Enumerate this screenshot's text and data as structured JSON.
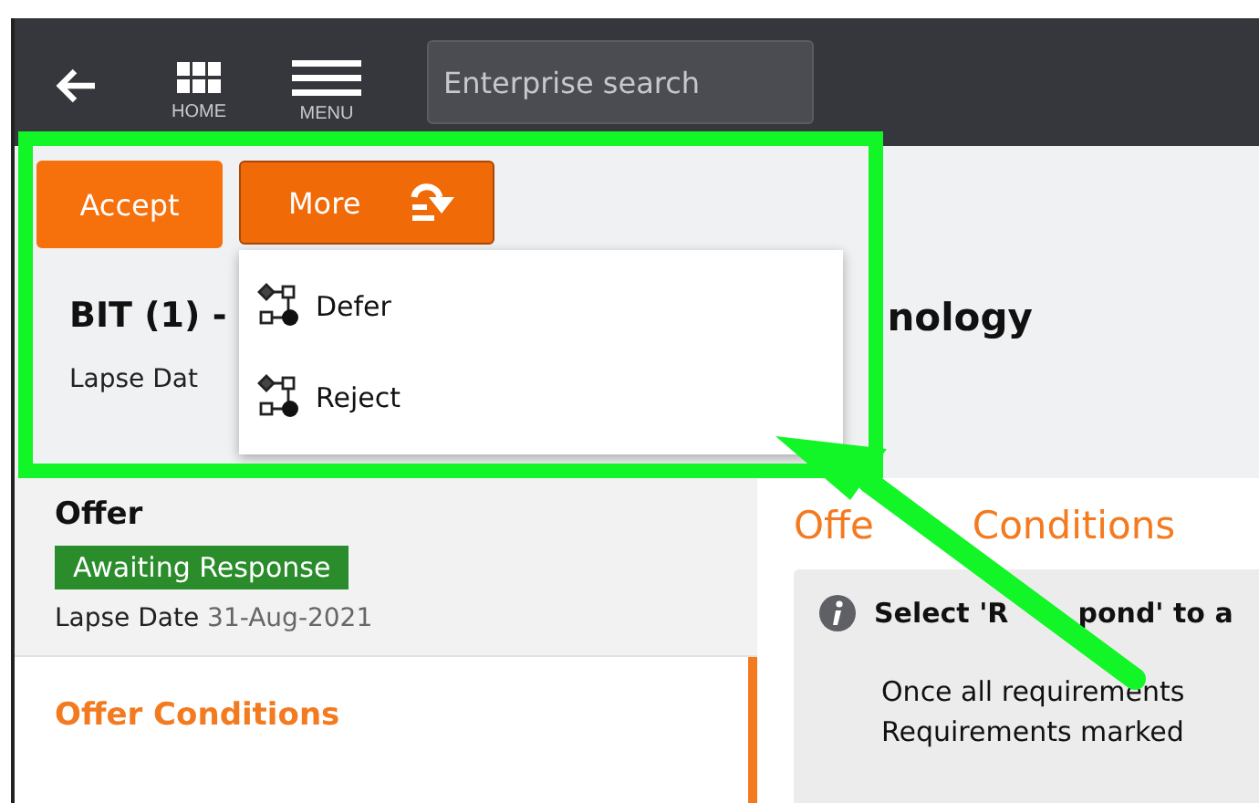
{
  "header": {
    "nav": [
      {
        "label": "HOME"
      },
      {
        "label": "MENU"
      }
    ],
    "search": {
      "placeholder": "Enterprise search"
    }
  },
  "actions": [
    {
      "label": "Accept",
      "kind": "plain"
    },
    {
      "label": "More",
      "kind": "dropdown"
    }
  ],
  "dropdown": {
    "items": [
      "Defer",
      "Reject"
    ]
  },
  "case": {
    "title_parts": [
      "BIT (1) -",
      "nology"
    ],
    "lapse_label": "Lapse Dat"
  },
  "offer": {
    "title": "Offer",
    "status": "Awaiting Response",
    "lapse_label": "Lapse Date",
    "lapse_date": "31-Aug-2021"
  },
  "sections": [
    {
      "label": "Offer Conditions",
      "selected": true
    }
  ],
  "main": {
    "heading_parts": [
      "Offe",
      "Conditions"
    ],
    "notice": {
      "title_parts": [
        "Select 'R",
        "pond' to a"
      ],
      "lines": [
        "Once all requirements",
        "Requirements marked"
      ]
    }
  }
}
